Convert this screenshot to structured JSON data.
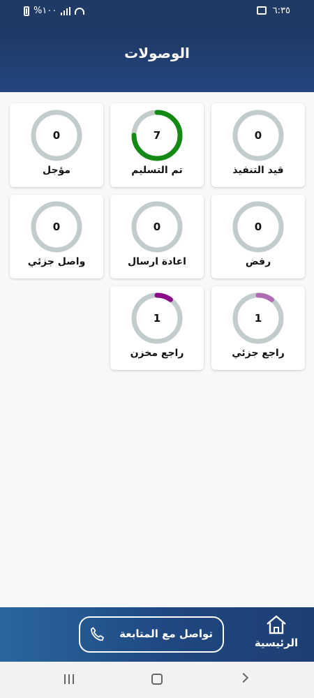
{
  "status_bar": {
    "time": "٦:٣٥",
    "battery": "%١٠٠"
  },
  "header": {
    "title": "الوصولات"
  },
  "cards": [
    {
      "label": "قيد التنفيذ",
      "value": "0",
      "progress": 0,
      "color": "#c2cccc"
    },
    {
      "label": "تم التسليم",
      "value": "7",
      "progress": 0.75,
      "color": "#148a14"
    },
    {
      "label": "مؤجل",
      "value": "0",
      "progress": 0,
      "color": "#c2cccc"
    },
    {
      "label": "رفض",
      "value": "0",
      "progress": 0,
      "color": "#c2cccc"
    },
    {
      "label": "اعادة ارسال",
      "value": "0",
      "progress": 0,
      "color": "#c2cccc"
    },
    {
      "label": "واصل جزئي",
      "value": "0",
      "progress": 0,
      "color": "#c2cccc"
    },
    {
      "label": "راجع جزئي",
      "value": "1",
      "progress": 0.1,
      "color": "#b06ab3"
    },
    {
      "label": "راجع مخزن",
      "value": "1",
      "progress": 0.1,
      "color": "#8a0a8a"
    }
  ],
  "bottom_bar": {
    "home_label": "الرئيسية",
    "contact_label": "تواصل مع المتابعة"
  },
  "colors": {
    "header": "#1f3a64",
    "ring_track": "#c2cccc"
  }
}
